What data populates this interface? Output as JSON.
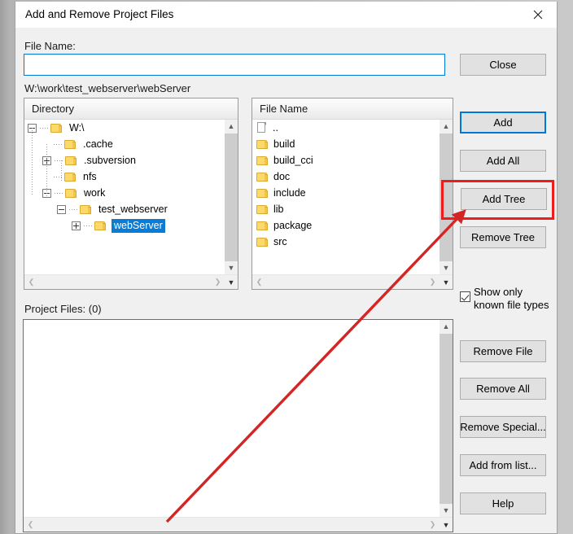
{
  "window": {
    "title": "Add and Remove Project Files",
    "close_icon": "close-icon"
  },
  "form": {
    "file_name_label": "File Name:",
    "file_name_value": "",
    "file_name_placeholder": "",
    "current_path": "W:\\work\\test_webserver\\webServer",
    "project_files_label": "Project Files: (0)"
  },
  "directory_panel": {
    "header": "Directory",
    "tree": [
      {
        "label": "W:\\",
        "depth": 0,
        "toggle": "minus",
        "icon": "folder-icon",
        "selected": false
      },
      {
        "label": ".cache",
        "depth": 1,
        "toggle": "none",
        "icon": "folder-icon",
        "selected": false
      },
      {
        "label": ".subversion",
        "depth": 1,
        "toggle": "plus",
        "icon": "folder-icon",
        "selected": false
      },
      {
        "label": "nfs",
        "depth": 1,
        "toggle": "none",
        "icon": "folder-icon",
        "selected": false
      },
      {
        "label": "work",
        "depth": 1,
        "toggle": "minus",
        "icon": "folder-icon",
        "selected": false
      },
      {
        "label": "test_webserver",
        "depth": 2,
        "toggle": "minus",
        "icon": "folder-icon",
        "selected": false
      },
      {
        "label": "webServer",
        "depth": 3,
        "toggle": "plus",
        "icon": "folder-icon",
        "selected": true
      }
    ]
  },
  "file_panel": {
    "header": "File Name",
    "items": [
      {
        "label": "..",
        "icon": "file-icon"
      },
      {
        "label": "build",
        "icon": "folder-icon"
      },
      {
        "label": "build_cci",
        "icon": "folder-icon"
      },
      {
        "label": "doc",
        "icon": "folder-icon"
      },
      {
        "label": "include",
        "icon": "folder-icon"
      },
      {
        "label": "lib",
        "icon": "folder-icon"
      },
      {
        "label": "package",
        "icon": "folder-icon"
      },
      {
        "label": "src",
        "icon": "folder-icon"
      }
    ]
  },
  "project_files": {
    "items": []
  },
  "buttons": {
    "close": "Close",
    "add": "Add",
    "add_all": "Add All",
    "add_tree": "Add Tree",
    "remove_tree": "Remove Tree",
    "remove_file": "Remove File",
    "remove_all": "Remove All",
    "remove_special": "Remove Special...",
    "add_from_list": "Add from list...",
    "help": "Help"
  },
  "options": {
    "show_only_known_label": "Show only known file types",
    "show_only_known_checked": true
  },
  "annotations": {
    "highlight_target": "Add Tree",
    "highlight_color": "#ee1c1c",
    "arrow_color": "#d42525"
  },
  "colors": {
    "accent": "#0078d7",
    "selection": "#0a7cd6",
    "folder": "#fbd96a",
    "button_face": "#e1e1e1",
    "dialog_face": "#f0f0f0"
  }
}
